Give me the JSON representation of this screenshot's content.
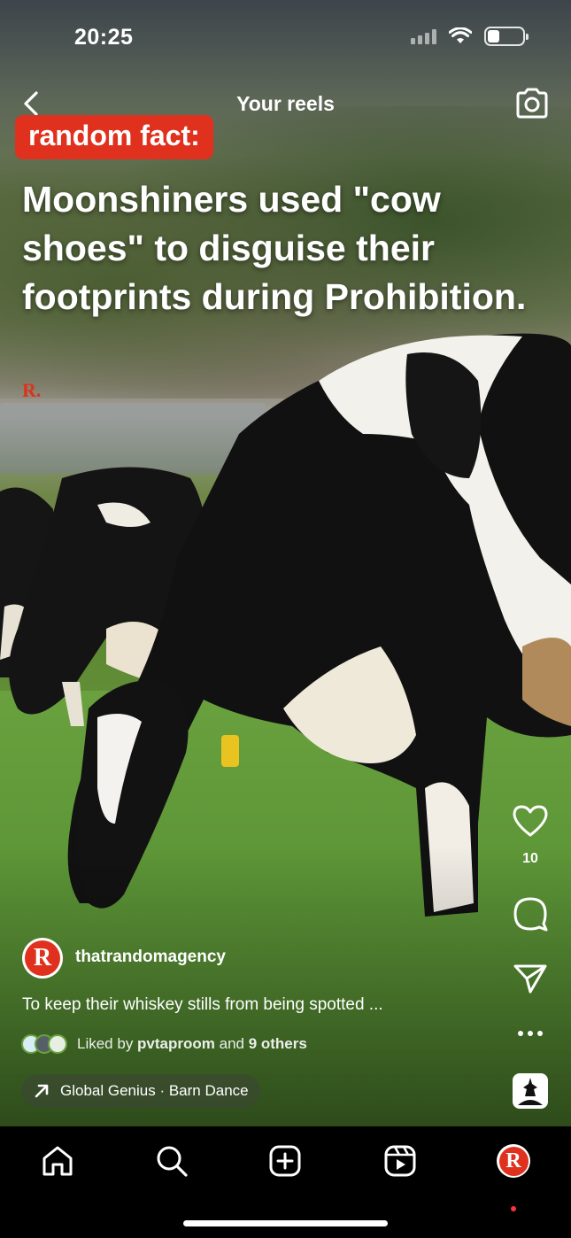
{
  "status_bar": {
    "time": "20:25",
    "battery_level": 0.35
  },
  "header": {
    "title": "Your reels"
  },
  "overlay": {
    "badge": "random fact:",
    "headline": "Moonshiners used \"cow shoes\" to disguise their footprints during Prohibition.",
    "brand_mark": "R."
  },
  "actions": {
    "like_count": "10"
  },
  "post": {
    "avatar_letter": "R",
    "username": "thatrandomagency",
    "caption": "To keep their whiskey stills from being spotted ...",
    "liked_by_prefix": "Liked by ",
    "liked_by_user": "pvtaproom",
    "liked_by_mid": " and ",
    "liked_by_others": "9 others",
    "audio": "Global Genius · Barn Dance"
  },
  "audio_thumb_label": "GLOBAL GENIUS",
  "nav": {
    "profile_letter": "R"
  },
  "colors": {
    "accent": "#e0301e",
    "notification_dot": "#ff3040"
  }
}
